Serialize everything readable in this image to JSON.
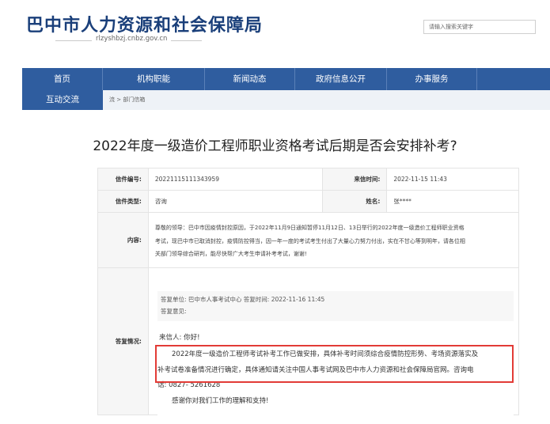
{
  "header": {
    "site_title": "巴中市人力资源和社会保障局",
    "site_domain": "rlzyshbzj.cnbz.gov.cn",
    "search_placeholder": "请输入搜索关键字"
  },
  "nav": {
    "items": [
      "首页",
      "机构职能",
      "新闻动态",
      "政府信息公开",
      "办事服务"
    ],
    "hover_item": "互动交流"
  },
  "breadcrumb": "流 > 部门信箱",
  "page_title": "2022年度一级造价工程师职业资格考试后期是否会安排补考?",
  "letter": {
    "number_label": "信件编号:",
    "number_value": "20221115111343959",
    "time_label": "来信时间:",
    "time_value": "2022-11-15 11:43",
    "type_label": "信件类型:",
    "type_value": "咨询",
    "name_label": "姓名:",
    "name_value": "张****",
    "content_label": "内容:",
    "content_lines": [
      "尊敬的领导：巴中市因疫情封控原因，于2022年11月9日通知暂停11月12日、13日举行的2022年度一级造价工程师职业资格",
      "考试，现巴中市已取消封控，疫情防控得当，因一年一度的考试考生付出了大量心力努力付出，实在不甘心等到明年，请各位相",
      "关部门领导综合研判，能尽快帮广大考生申请补考考试，谢谢!"
    ],
    "reply_label": "答复情况:",
    "reply_meta_line1": "答复单位: 巴中市人事考试中心   答复时间: 2022-11-16 11:45",
    "reply_meta_line2": "答复意见:",
    "reply_greeting": "来信人: 你好!",
    "reply_body_1": "2022年度一级造价工程师考试补考工作已做安排，具体补考时间须综合疫情防控形势、考场资源落实及",
    "reply_body_2": "补考试卷准备情况进行确定，具体通知请关注中国人事考试网及巴中市人力资源和社会保障局官网。咨询电",
    "reply_body_3": "话: 0827- 5261628",
    "reply_thanks": "感谢你对我们工作的理解和支持!"
  },
  "colors": {
    "brand_blue": "#2f5d9f",
    "title_blue": "#1a3f7a",
    "highlight_red": "#e23b36"
  }
}
